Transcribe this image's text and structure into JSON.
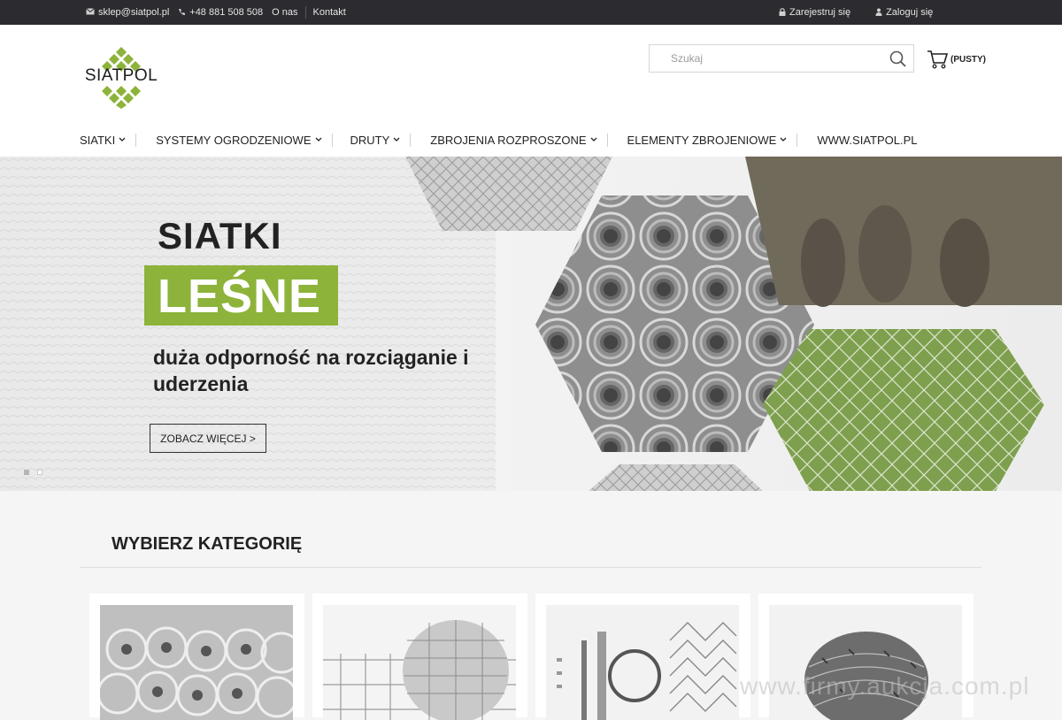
{
  "topbar": {
    "email": "sklep@siatpol.pl",
    "phone": "+48 881 508 508",
    "about": "O nas",
    "contact": "Kontakt",
    "register": "Zarejestruj się",
    "login": "Zaloguj się"
  },
  "header": {
    "logo_text": "SIATPOL",
    "search_placeholder": "Szukaj",
    "cart_label": "(PUSTY)"
  },
  "nav": {
    "items": [
      {
        "label": "SIATKI",
        "has_dropdown": true
      },
      {
        "label": "SYSTEMY OGRODZENIOWE",
        "has_dropdown": true
      },
      {
        "label": "DRUTY",
        "has_dropdown": true
      },
      {
        "label": "ZBROJENIA ROZPROSZONE",
        "has_dropdown": true
      },
      {
        "label": "ELEMENTY ZBROJENIOWE",
        "has_dropdown": true
      },
      {
        "label": "WWW.SIATPOL.PL",
        "has_dropdown": false
      }
    ]
  },
  "hero": {
    "title": "SIATKI",
    "badge": "LEŚNE",
    "subtitle": "duża odporność na rozciąganie i uderzenia",
    "button": "ZOBACZ WIĘCEJ >",
    "slides_total": 2,
    "active_slide": 2
  },
  "categories": {
    "title": "WYBIERZ KATEGORIĘ"
  },
  "watermark": "www.firmy.aukcja.com.pl",
  "colors": {
    "topbar_bg": "#2b2b30",
    "accent_green": "#8db33a",
    "page_bg": "#f5f5f5"
  }
}
